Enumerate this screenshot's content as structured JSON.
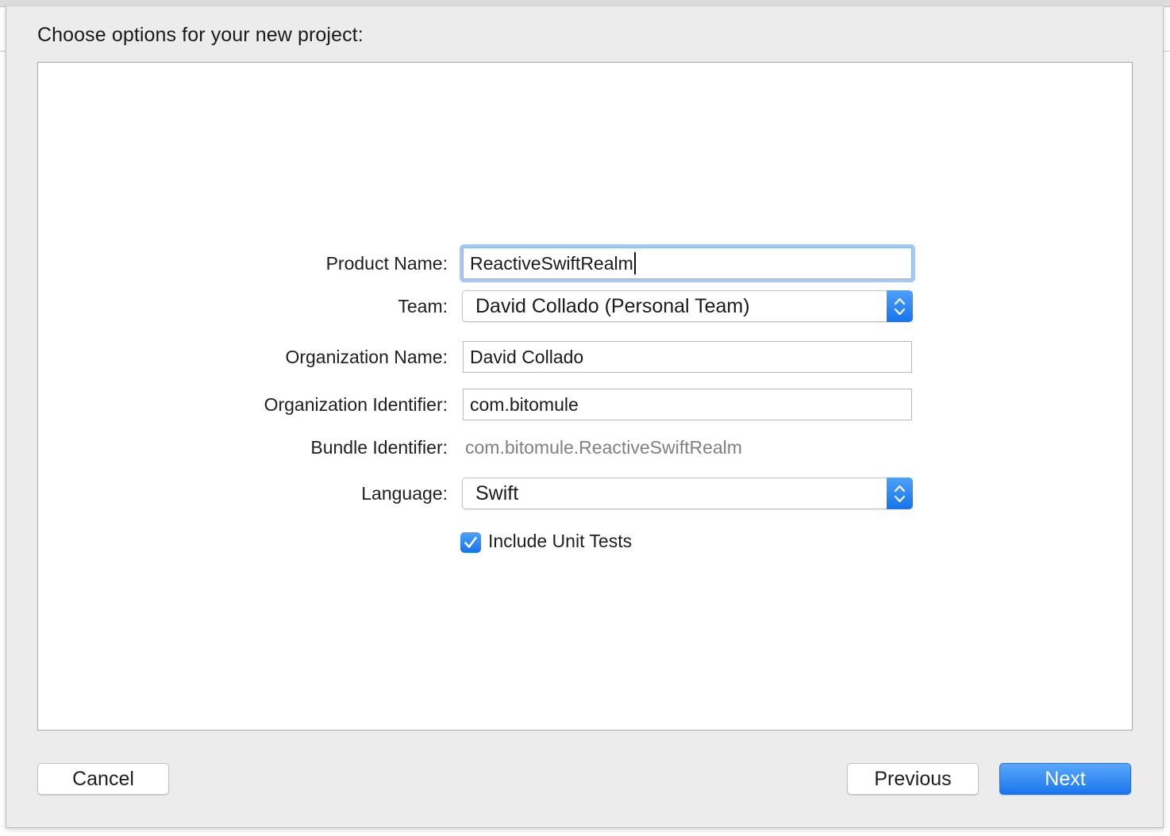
{
  "dialog": {
    "title": "Choose options for your new project:"
  },
  "form": {
    "product_name": {
      "label": "Product Name:",
      "value": "ReactiveSwiftRealm"
    },
    "team": {
      "label": "Team:",
      "value": "David Collado (Personal Team)"
    },
    "organization_name": {
      "label": "Organization Name:",
      "value": "David Collado"
    },
    "organization_identifier": {
      "label": "Organization Identifier:",
      "value": "com.bitomule"
    },
    "bundle_identifier": {
      "label": "Bundle Identifier:",
      "value": "com.bitomule.ReactiveSwiftRealm"
    },
    "language": {
      "label": "Language:",
      "value": "Swift"
    },
    "include_unit_tests": {
      "label": "Include Unit Tests",
      "checked": true
    }
  },
  "buttons": {
    "cancel": "Cancel",
    "previous": "Previous",
    "next": "Next"
  },
  "colors": {
    "accent": "#1a76ee",
    "focus_ring": "#a6c8f4",
    "sheet_background": "#ececec"
  },
  "icons": {
    "stepper": "up-down-chevron-icon",
    "check": "checkmark-icon"
  }
}
